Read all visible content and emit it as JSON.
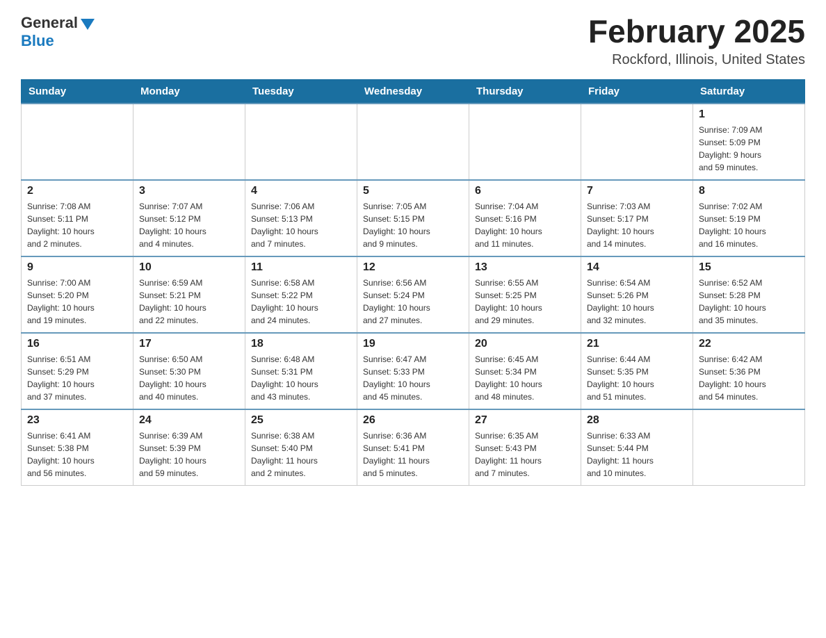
{
  "header": {
    "logo_general": "General",
    "logo_blue": "Blue",
    "month_title": "February 2025",
    "location": "Rockford, Illinois, United States"
  },
  "days_of_week": [
    "Sunday",
    "Monday",
    "Tuesday",
    "Wednesday",
    "Thursday",
    "Friday",
    "Saturday"
  ],
  "weeks": [
    [
      {
        "day": "",
        "info": ""
      },
      {
        "day": "",
        "info": ""
      },
      {
        "day": "",
        "info": ""
      },
      {
        "day": "",
        "info": ""
      },
      {
        "day": "",
        "info": ""
      },
      {
        "day": "",
        "info": ""
      },
      {
        "day": "1",
        "info": "Sunrise: 7:09 AM\nSunset: 5:09 PM\nDaylight: 9 hours\nand 59 minutes."
      }
    ],
    [
      {
        "day": "2",
        "info": "Sunrise: 7:08 AM\nSunset: 5:11 PM\nDaylight: 10 hours\nand 2 minutes."
      },
      {
        "day": "3",
        "info": "Sunrise: 7:07 AM\nSunset: 5:12 PM\nDaylight: 10 hours\nand 4 minutes."
      },
      {
        "day": "4",
        "info": "Sunrise: 7:06 AM\nSunset: 5:13 PM\nDaylight: 10 hours\nand 7 minutes."
      },
      {
        "day": "5",
        "info": "Sunrise: 7:05 AM\nSunset: 5:15 PM\nDaylight: 10 hours\nand 9 minutes."
      },
      {
        "day": "6",
        "info": "Sunrise: 7:04 AM\nSunset: 5:16 PM\nDaylight: 10 hours\nand 11 minutes."
      },
      {
        "day": "7",
        "info": "Sunrise: 7:03 AM\nSunset: 5:17 PM\nDaylight: 10 hours\nand 14 minutes."
      },
      {
        "day": "8",
        "info": "Sunrise: 7:02 AM\nSunset: 5:19 PM\nDaylight: 10 hours\nand 16 minutes."
      }
    ],
    [
      {
        "day": "9",
        "info": "Sunrise: 7:00 AM\nSunset: 5:20 PM\nDaylight: 10 hours\nand 19 minutes."
      },
      {
        "day": "10",
        "info": "Sunrise: 6:59 AM\nSunset: 5:21 PM\nDaylight: 10 hours\nand 22 minutes."
      },
      {
        "day": "11",
        "info": "Sunrise: 6:58 AM\nSunset: 5:22 PM\nDaylight: 10 hours\nand 24 minutes."
      },
      {
        "day": "12",
        "info": "Sunrise: 6:56 AM\nSunset: 5:24 PM\nDaylight: 10 hours\nand 27 minutes."
      },
      {
        "day": "13",
        "info": "Sunrise: 6:55 AM\nSunset: 5:25 PM\nDaylight: 10 hours\nand 29 minutes."
      },
      {
        "day": "14",
        "info": "Sunrise: 6:54 AM\nSunset: 5:26 PM\nDaylight: 10 hours\nand 32 minutes."
      },
      {
        "day": "15",
        "info": "Sunrise: 6:52 AM\nSunset: 5:28 PM\nDaylight: 10 hours\nand 35 minutes."
      }
    ],
    [
      {
        "day": "16",
        "info": "Sunrise: 6:51 AM\nSunset: 5:29 PM\nDaylight: 10 hours\nand 37 minutes."
      },
      {
        "day": "17",
        "info": "Sunrise: 6:50 AM\nSunset: 5:30 PM\nDaylight: 10 hours\nand 40 minutes."
      },
      {
        "day": "18",
        "info": "Sunrise: 6:48 AM\nSunset: 5:31 PM\nDaylight: 10 hours\nand 43 minutes."
      },
      {
        "day": "19",
        "info": "Sunrise: 6:47 AM\nSunset: 5:33 PM\nDaylight: 10 hours\nand 45 minutes."
      },
      {
        "day": "20",
        "info": "Sunrise: 6:45 AM\nSunset: 5:34 PM\nDaylight: 10 hours\nand 48 minutes."
      },
      {
        "day": "21",
        "info": "Sunrise: 6:44 AM\nSunset: 5:35 PM\nDaylight: 10 hours\nand 51 minutes."
      },
      {
        "day": "22",
        "info": "Sunrise: 6:42 AM\nSunset: 5:36 PM\nDaylight: 10 hours\nand 54 minutes."
      }
    ],
    [
      {
        "day": "23",
        "info": "Sunrise: 6:41 AM\nSunset: 5:38 PM\nDaylight: 10 hours\nand 56 minutes."
      },
      {
        "day": "24",
        "info": "Sunrise: 6:39 AM\nSunset: 5:39 PM\nDaylight: 10 hours\nand 59 minutes."
      },
      {
        "day": "25",
        "info": "Sunrise: 6:38 AM\nSunset: 5:40 PM\nDaylight: 11 hours\nand 2 minutes."
      },
      {
        "day": "26",
        "info": "Sunrise: 6:36 AM\nSunset: 5:41 PM\nDaylight: 11 hours\nand 5 minutes."
      },
      {
        "day": "27",
        "info": "Sunrise: 6:35 AM\nSunset: 5:43 PM\nDaylight: 11 hours\nand 7 minutes."
      },
      {
        "day": "28",
        "info": "Sunrise: 6:33 AM\nSunset: 5:44 PM\nDaylight: 11 hours\nand 10 minutes."
      },
      {
        "day": "",
        "info": ""
      }
    ]
  ]
}
